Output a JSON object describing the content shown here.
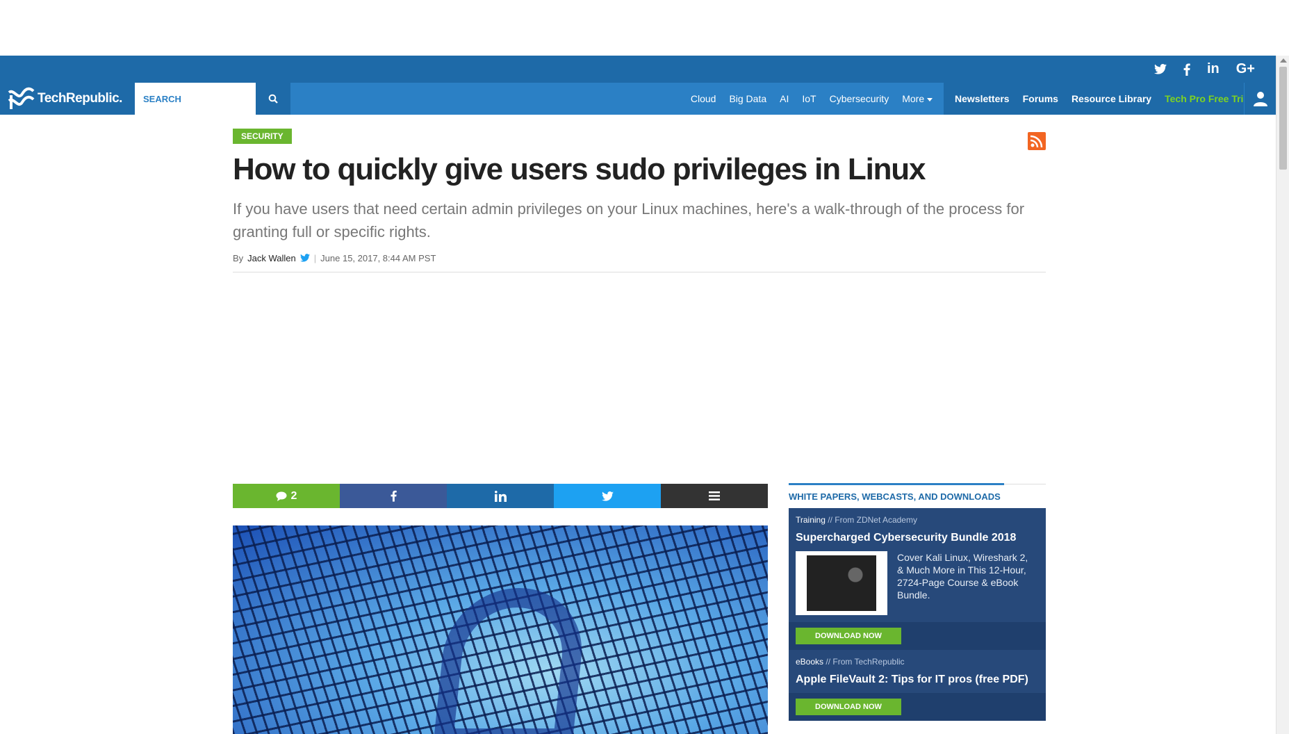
{
  "social": {
    "twitter_icon": "twitter-icon",
    "facebook_icon": "facebook-icon",
    "linkedin_label": "in",
    "gplus_label": "G+"
  },
  "nav": {
    "logo_text": "TechRepublic.",
    "search_placeholder": "SEARCH",
    "links": [
      "Cloud",
      "Big Data",
      "AI",
      "IoT",
      "Cybersecurity",
      "More"
    ],
    "right_links": [
      "Newsletters",
      "Forums",
      "Resource Library",
      "Tech Pro Free Trial"
    ],
    "colors": {
      "bar": "#2b80c5",
      "dark": "#1e6aa8",
      "trial": "#7ed321"
    }
  },
  "article": {
    "category": "SECURITY",
    "title": "How to quickly give users sudo privileges in Linux",
    "subtitle": "If you have users that need certain admin privileges on your Linux machines, here's a walk-through of the process for granting full or specific rights.",
    "by": "By",
    "author": "Jack Wallen",
    "date": "June 15, 2017, 8:44 AM PST"
  },
  "share": {
    "comment_count": "2"
  },
  "sidebar": {
    "heading": "WHITE PAPERS, WEBCASTS, AND DOWNLOADS",
    "promos": [
      {
        "type": "Training",
        "sep": "//",
        "from": "From ZDNet Academy",
        "title": "Supercharged Cybersecurity Bundle 2018",
        "desc": "Cover Kali Linux, Wireshark 2, & Much More in This 12-Hour, 2724-Page Course & eBook Bundle.",
        "button": "DOWNLOAD NOW"
      },
      {
        "type": "eBooks",
        "sep": "//",
        "from": "From TechRepublic",
        "title": "Apple FileVault 2: Tips for IT pros (free PDF)",
        "button": "DOWNLOAD NOW"
      }
    ]
  }
}
